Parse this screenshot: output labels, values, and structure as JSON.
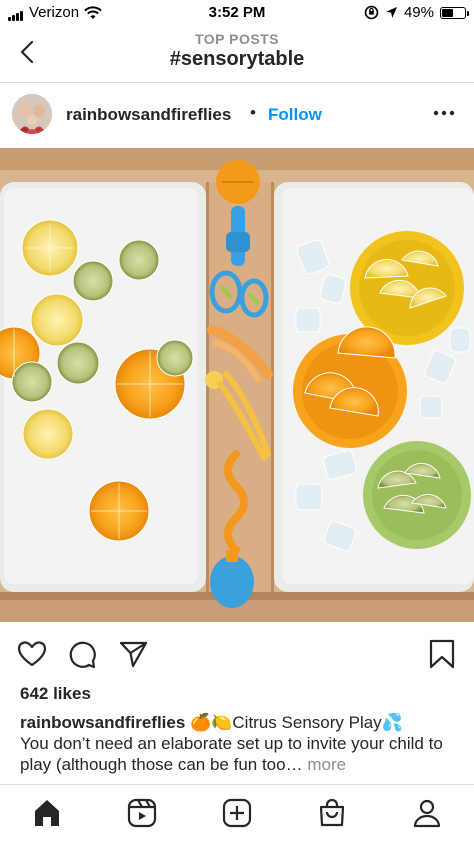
{
  "status_bar": {
    "carrier": "Verizon",
    "time": "3:52 PM",
    "battery": "49%",
    "battery_level": 0.49
  },
  "nav": {
    "subtitle": "TOP POSTS",
    "title": "#sensorytable",
    "back_icon": "chevron-left-icon"
  },
  "post": {
    "username": "rainbowsandfireflies",
    "separator": "•",
    "follow_label": "Follow",
    "more_icon": "more-dots-icon",
    "likes": "642 likes",
    "caption": {
      "username": "rainbowsandfireflies",
      "emojis": "🍊🍋",
      "title_text": "Citrus Sensory Play",
      "title_emoji": "💦",
      "body": "You don’t need an elaborate set up to invite your child to play (although those can be fun too…",
      "more_label": "more"
    }
  },
  "actions": {
    "like_icon": "heart-icon",
    "comment_icon": "comment-icon",
    "share_icon": "share-icon",
    "save_icon": "bookmark-icon"
  },
  "tabs": [
    "home-icon",
    "reels-icon",
    "new-post-icon",
    "shop-icon",
    "profile-icon"
  ],
  "colors": {
    "accent": "#0095f6",
    "text": "#262626",
    "muted": "#8e8e8e"
  }
}
